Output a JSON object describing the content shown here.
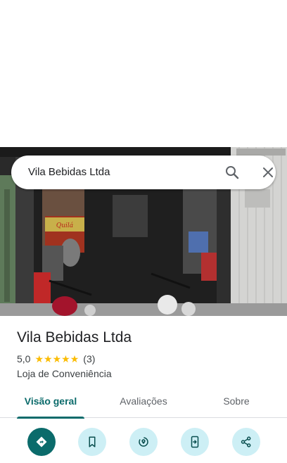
{
  "search": {
    "query": "Vila Bebidas Ltda",
    "search_icon": "search-icon",
    "close_icon": "close-icon"
  },
  "photo": {
    "description_icon": "storefront-photo",
    "sign_text": "Quilá"
  },
  "place": {
    "name": "Vila Bebidas Ltda",
    "rating": "5,0",
    "stars": 5,
    "review_count": "(3)",
    "category": "Loja de Conveniência"
  },
  "tabs": [
    {
      "label": "Visão geral",
      "active": true
    },
    {
      "label": "Avaliações",
      "active": false
    },
    {
      "label": "Sobre",
      "active": false
    }
  ],
  "actions": [
    {
      "name": "directions",
      "icon": "directions-icon"
    },
    {
      "name": "save",
      "icon": "bookmark-icon"
    },
    {
      "name": "nearby",
      "icon": "nearby-pin-icon"
    },
    {
      "name": "send-to-phone",
      "icon": "send-to-phone-icon"
    },
    {
      "name": "share",
      "icon": "share-icon"
    }
  ],
  "colors": {
    "accent": "#0b6b6b",
    "action_bg": "#cdeff5",
    "star": "#fbbc04",
    "text": "#202124"
  }
}
